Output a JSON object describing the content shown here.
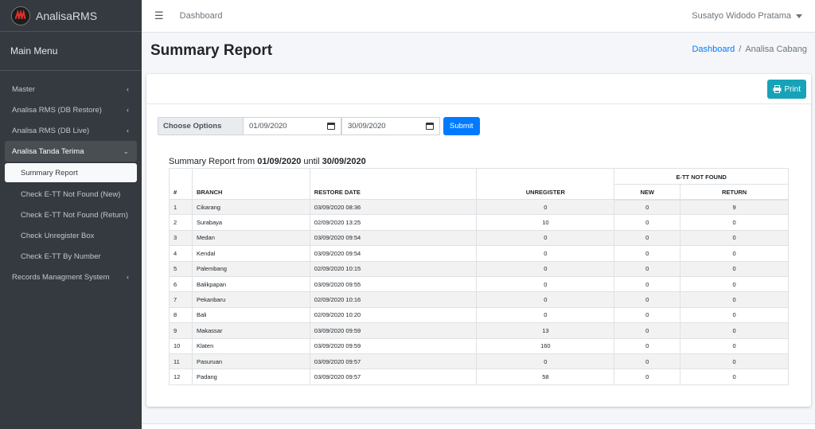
{
  "app": {
    "name": "AnalisaRMS"
  },
  "sidebar": {
    "heading": "Main Menu",
    "items": [
      {
        "label": "Master",
        "chevron": "‹"
      },
      {
        "label": "Analisa RMS (DB Restore)",
        "chevron": "‹"
      },
      {
        "label": "Analisa RMS (DB Live)",
        "chevron": "‹"
      },
      {
        "label": "Analisa Tanda Terima",
        "chevron": "⌄"
      }
    ],
    "subitems": [
      {
        "label": "Summary Report"
      },
      {
        "label": "Check E-TT Not Found (New)"
      },
      {
        "label": "Check E-TT Not Found (Return)"
      },
      {
        "label": "Check Unregister Box"
      },
      {
        "label": "Check E-TT By Number"
      }
    ],
    "last_item": {
      "label": "Records Managment System",
      "chevron": "‹"
    }
  },
  "topbar": {
    "menu_icon": "☰",
    "link": "Dashboard",
    "user": "Susatyo Widodo Pratama"
  },
  "page": {
    "title": "Summary Report"
  },
  "breadcrumb": {
    "home": "Dashboard",
    "sep": "/",
    "current": "Analisa Cabang"
  },
  "card": {
    "print_label": "Print",
    "filter": {
      "label": "Choose Options",
      "start": "01/09/2020",
      "end": "30/09/2020",
      "submit": "Submit"
    },
    "report": {
      "prefix": "Summary Report from",
      "from": "01/09/2020",
      "until_word": "until",
      "to": "30/09/2020"
    }
  },
  "table": {
    "group_header": "E-TT NOT FOUND",
    "headers": {
      "num": "#",
      "branch": "BRANCH",
      "restore_date": "RESTORE DATE",
      "unregister": "UNREGISTER",
      "new": "NEW",
      "return": "RETURN"
    },
    "rows": [
      [
        "1",
        "Cikarang",
        "03/09/2020 08:36",
        "0",
        "0",
        "9"
      ],
      [
        "2",
        "Surabaya",
        "02/09/2020 13:25",
        "10",
        "0",
        "0"
      ],
      [
        "3",
        "Medan",
        "03/09/2020 09:54",
        "0",
        "0",
        "0"
      ],
      [
        "4",
        "Kendal",
        "03/09/2020 09:54",
        "0",
        "0",
        "0"
      ],
      [
        "5",
        "Palembang",
        "02/09/2020 10:15",
        "0",
        "0",
        "0"
      ],
      [
        "6",
        "Balikpapan",
        "03/09/2020 09:55",
        "0",
        "0",
        "0"
      ],
      [
        "7",
        "Pekanbaru",
        "02/09/2020 10:16",
        "0",
        "0",
        "0"
      ],
      [
        "8",
        "Bali",
        "02/09/2020 10:20",
        "0",
        "0",
        "0"
      ],
      [
        "9",
        "Makassar",
        "03/09/2020 09:59",
        "13",
        "0",
        "0"
      ],
      [
        "10",
        "Klaten",
        "03/09/2020 09:59",
        "160",
        "0",
        "0"
      ],
      [
        "11",
        "Pasuruan",
        "03/09/2020 09:57",
        "0",
        "0",
        "0"
      ],
      [
        "12",
        "Padang",
        "03/09/2020 09:57",
        "58",
        "0",
        "0"
      ]
    ]
  },
  "colors": {
    "sidebar_bg": "#343a40",
    "primary": "#007bff",
    "info": "#17a2b8"
  }
}
